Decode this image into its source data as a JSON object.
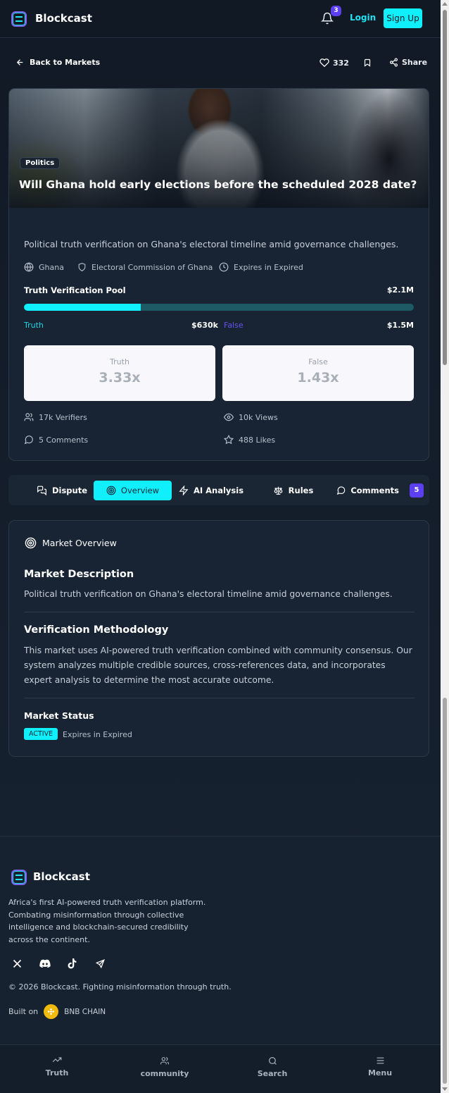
{
  "header": {
    "brand": "Blockcast",
    "notification_count": "3",
    "login": "Login",
    "signup": "Sign Up"
  },
  "subheader": {
    "back": "Back to Markets",
    "likes": "332",
    "share": "Share"
  },
  "market": {
    "category": "Politics",
    "title": "Will Ghana hold early elections before the scheduled 2028 date?",
    "description": "Political truth verification on Ghana's electoral timeline amid governance challenges.",
    "country": "Ghana",
    "source": "Electoral Commission of Ghana",
    "expires": "Expires in Expired",
    "pool_label": "Truth Verification Pool",
    "pool_total": "$2.1M",
    "truth_share_percent": 30,
    "truth_label": "Truth",
    "truth_amount": "$630k",
    "false_label": "False",
    "false_amount": "$1.5M",
    "truth_odds_label": "Truth",
    "truth_odds": "3.33x",
    "false_odds_label": "False",
    "false_odds": "1.43x",
    "verifiers": "17k Verifiers",
    "views": "10k Views",
    "comments": "5 Comments",
    "likes": "488 Likes"
  },
  "tabs": [
    {
      "label": "Dispute"
    },
    {
      "label": "Overview",
      "active": true
    },
    {
      "label": "AI Analysis"
    },
    {
      "label": "Rules"
    },
    {
      "label": "Comments",
      "count": "5"
    }
  ],
  "overview": {
    "heading": "Market Overview",
    "desc_title": "Market Description",
    "desc_text": "Political truth verification on Ghana's electoral timeline amid governance challenges.",
    "method_title": "Verification Methodology",
    "method_text": "This market uses AI-powered truth verification combined with community consensus. Our system analyzes multiple credible sources, cross-references data, and incorporates expert analysis to determine the most accurate outcome.",
    "status_title": "Market Status",
    "status_badge": "ACTIVE",
    "status_expires": "Expires in Expired"
  },
  "footer": {
    "brand": "Blockcast",
    "about": "Africa's first AI-powered truth verification platform. Combating misinformation through collective intelligence and blockchain-secured credibility across the continent.",
    "copyright": "© 2026 Blockcast. Fighting misinformation through truth.",
    "built_on": "Built on",
    "chain": "BNB CHAIN",
    "socials": [
      "x-icon",
      "discord-icon",
      "tiktok-icon",
      "telegram-icon"
    ]
  },
  "bottom_nav": [
    {
      "label": "Truth",
      "icon": "trending-up-icon"
    },
    {
      "label": "community",
      "icon": "users-icon"
    },
    {
      "label": "Search",
      "icon": "search-icon"
    },
    {
      "label": "Menu",
      "icon": "menu-icon"
    }
  ],
  "colors": {
    "accent": "#0ff0fc",
    "purple": "#5b3ff0",
    "background": "#121a26"
  }
}
